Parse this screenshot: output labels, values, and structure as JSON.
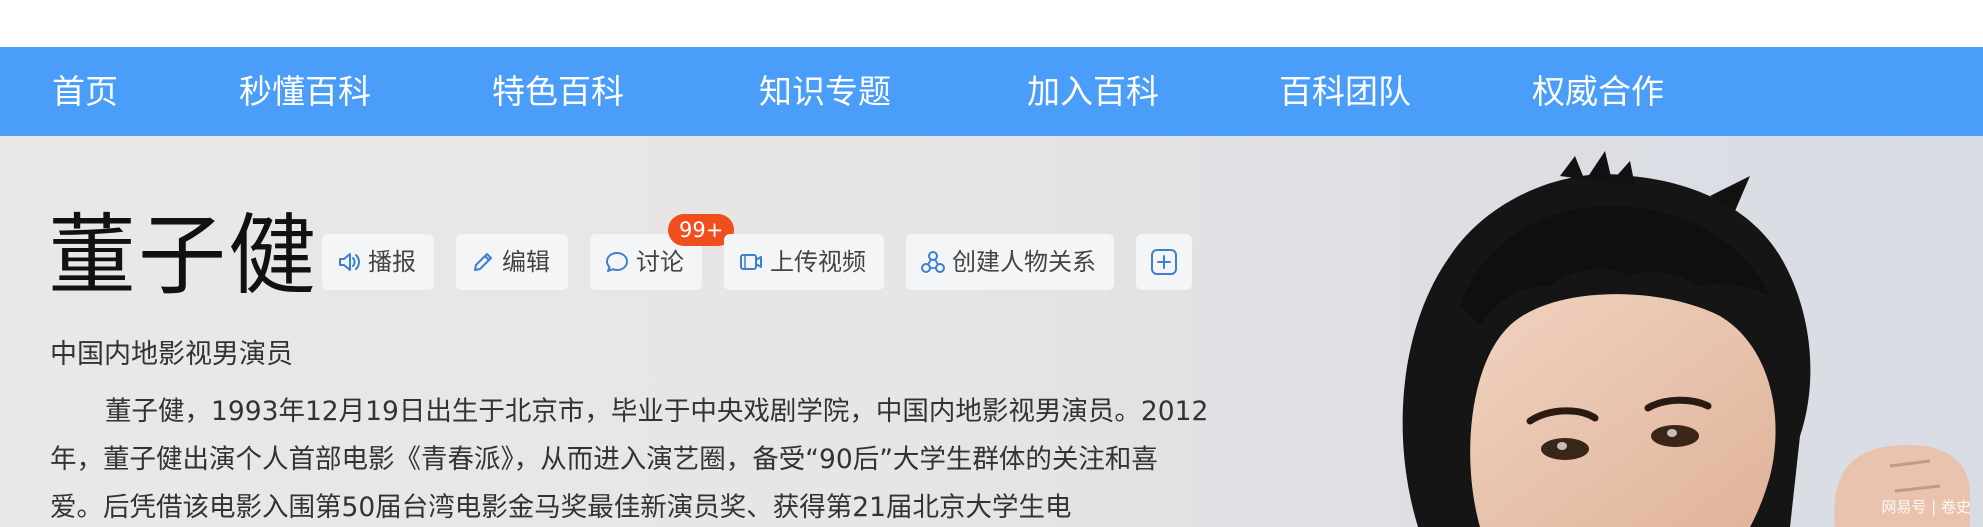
{
  "nav": {
    "items": [
      {
        "label": "首页"
      },
      {
        "label": "秒懂百科"
      },
      {
        "label": "特色百科"
      },
      {
        "label": "知识专题"
      },
      {
        "label": "加入百科"
      },
      {
        "label": "百科团队"
      },
      {
        "label": "权威合作"
      }
    ]
  },
  "entry": {
    "title": "董子健",
    "subtitle": "中国内地影视男演员",
    "summary": "董子健，1993年12月19日出生于北京市，毕业于中央戏剧学院，中国内地影视男演员。2012年，董子健出演个人首部电影《青春派》，从而进入演艺圈，备受“90后”大学生群体的关注和喜爱。后凭借该电影入围第50届台湾电影金马奖最佳新演员奖、获得第21届北京大学生电"
  },
  "actions": {
    "play_label": "播报",
    "edit_label": "编辑",
    "discuss_label": "讨论",
    "discuss_badge": "99+",
    "upload_label": "上传视频",
    "relation_label": "创建人物关系"
  },
  "watermark": "网易号 | 卷史",
  "colors": {
    "nav_bg": "#4a9df8",
    "badge_bg": "#f04f1d",
    "icon_blue": "#3d7fd1"
  }
}
